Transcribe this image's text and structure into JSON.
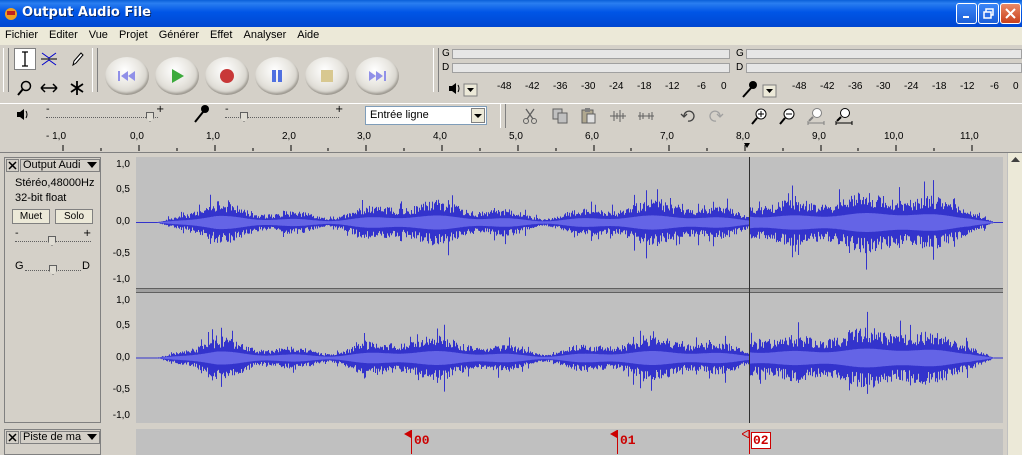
{
  "window": {
    "title": "Output Audio File",
    "colors": {
      "titlebar": "#0055e6",
      "waveform": "#3333cc",
      "label_red": "#cc0000"
    }
  },
  "menu": [
    "Fichier",
    "Editer",
    "Vue",
    "Projet",
    "Générer",
    "Effet",
    "Analyser",
    "Aide"
  ],
  "meters": {
    "channels": [
      "G",
      "D"
    ],
    "play_ticks": [
      "-48",
      "-42",
      "-36",
      "-30",
      "-24",
      "-18",
      "-12",
      "-6",
      "0"
    ],
    "record_ticks": [
      "-48",
      "-42",
      "-36",
      "-30",
      "-24",
      "-18",
      "-12",
      "-6",
      "0"
    ]
  },
  "mixer": {
    "input_source": "Entrée ligne",
    "minus": "-",
    "plus": "+"
  },
  "ruler": {
    "ticks": [
      "- 1,0",
      "0,0",
      "1,0",
      "2,0",
      "3,0",
      "4,0",
      "5,0",
      "6,0",
      "7,0",
      "8,0",
      "9,0",
      "10,0",
      "11,0"
    ]
  },
  "audio_track": {
    "name": "Output Audi",
    "format": "Stéréo,48000Hz",
    "bit_depth": "32-bit float",
    "mute_label": "Muet",
    "solo_label": "Solo",
    "gain_minus": "-",
    "gain_plus": "+",
    "pan_left": "G",
    "pan_right": "D",
    "amplitude_ticks": [
      "1,0",
      "0,5",
      "0,0",
      "-0,5",
      "-1,0"
    ]
  },
  "label_track": {
    "name": "Piste de ma",
    "labels": [
      "00",
      "01",
      "02"
    ]
  }
}
